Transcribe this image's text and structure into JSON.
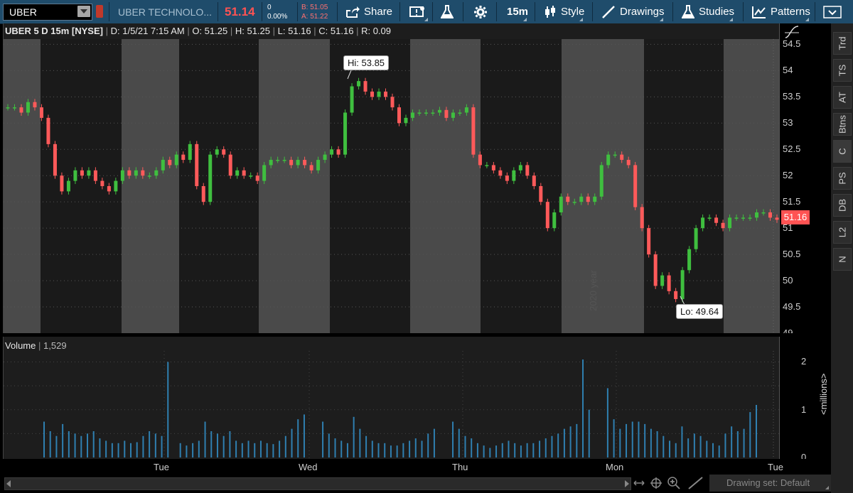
{
  "toolbar": {
    "symbol": "UBER",
    "company": "UBER TECHNOLO...",
    "last": "51.14",
    "change": "0",
    "change_pct": "0.00%",
    "bid": "B: 51.05",
    "ask": "A: 51.22",
    "share_label": "Share",
    "timeframe": "15m",
    "style_label": "Style",
    "drawings_label": "Drawings",
    "studies_label": "Studies",
    "patterns_label": "Patterns"
  },
  "chart_header": {
    "title": "UBER 5 D 15m [NYSE]",
    "date": "D: 1/5/21 7:15 AM",
    "open": "O: 51.25",
    "high": "H: 51.25",
    "low": "L: 51.16",
    "close": "C: 51.16",
    "range": "R: 0.09"
  },
  "volume_header": {
    "label": "Volume",
    "value": "1,529"
  },
  "labels": {
    "hi": "Hi: 53.85",
    "lo": "Lo: 49.64",
    "current_price": "51.16",
    "watermark": "2020 year",
    "millions": "<millions>",
    "drawing_set": "Drawing set: Default"
  },
  "price_axis_ticks": [
    "54.5",
    "54",
    "53.5",
    "53",
    "52.5",
    "52",
    "51.5",
    "51",
    "50.5",
    "50",
    "49.5",
    "49"
  ],
  "volume_axis_ticks": [
    "2",
    "1",
    "0"
  ],
  "time_ticks": [
    "Tue",
    "Wed",
    "Thu",
    "Mon",
    "Tue"
  ],
  "right_tabs": [
    "Trd",
    "TS",
    "AT",
    "Btns",
    "C",
    "PS",
    "DB",
    "L2",
    "N"
  ],
  "colors": {
    "up": "#3fbf3f",
    "down": "#ff5a5a",
    "volume": "#2f7fb0",
    "toolbar": "#1f4c6b"
  },
  "chart_data": {
    "type": "candlestick",
    "title": "UBER 5 D 15m [NYSE]",
    "ylim": [
      49,
      54.6
    ],
    "hi": 53.85,
    "lo": 49.64,
    "last": 51.16,
    "days": [
      "Tue",
      "Wed",
      "Thu",
      "Mon",
      "Tue"
    ],
    "close_path": [
      53.3,
      53.3,
      53.2,
      53.4,
      53.3,
      53.1,
      52.6,
      52.0,
      51.7,
      51.9,
      52.1,
      52.0,
      52.1,
      51.9,
      51.8,
      51.7,
      51.9,
      52.1,
      52.0,
      52.1,
      52.0,
      52.0,
      52.1,
      52.3,
      52.2,
      52.4,
      52.3,
      52.6,
      51.8,
      51.5,
      52.4,
      52.5,
      52.4,
      52.0,
      52.1,
      52.0,
      52.0,
      51.9,
      52.2,
      52.3,
      52.3,
      52.3,
      52.2,
      52.3,
      52.2,
      52.1,
      52.3,
      52.4,
      52.5,
      52.4,
      53.2,
      53.7,
      53.8,
      53.6,
      53.5,
      53.6,
      53.5,
      53.3,
      53.0,
      53.1,
      53.2,
      53.2,
      53.2,
      53.2,
      53.25,
      53.1,
      53.2,
      53.2,
      53.3,
      52.4,
      52.2,
      52.2,
      52.1,
      52.0,
      51.9,
      52.1,
      52.2,
      52.0,
      51.8,
      51.5,
      51.0,
      51.3,
      51.6,
      51.5,
      51.5,
      51.6,
      51.5,
      51.6,
      52.2,
      52.4,
      52.4,
      52.3,
      52.2,
      51.4,
      51.0,
      50.5,
      49.9,
      50.1,
      49.8,
      49.65,
      50.2,
      50.6,
      51.0,
      51.2,
      51.2,
      51.1,
      51.0,
      51.2,
      51.2,
      51.2,
      51.2,
      51.3,
      51.3,
      51.2,
      51.16
    ],
    "volume_millions": [
      0.75,
      0.55,
      0.45,
      0.7,
      0.55,
      0.5,
      0.45,
      0.5,
      0.55,
      0.4,
      0.35,
      0.3,
      0.3,
      0.35,
      0.3,
      0.32,
      0.45,
      0.55,
      0.5,
      0.45,
      2.0,
      0.0,
      0.3,
      0.25,
      0.3,
      0.35,
      0.75,
      0.55,
      0.5,
      0.45,
      0.55,
      0.35,
      0.3,
      0.35,
      0.3,
      0.35,
      0.3,
      0.28,
      0.35,
      0.45,
      0.6,
      0.8,
      0.9,
      0.0,
      0.0,
      0.75,
      0.5,
      0.4,
      0.35,
      0.3,
      0.85,
      0.6,
      0.45,
      0.35,
      0.3,
      0.3,
      0.25,
      0.25,
      0.3,
      0.35,
      0.4,
      0.35,
      0.5,
      0.6,
      0.0,
      0.0,
      0.75,
      0.6,
      0.45,
      0.4,
      0.3,
      0.25,
      0.2,
      0.25,
      0.3,
      0.35,
      0.3,
      0.25,
      0.3,
      0.3,
      0.35,
      0.4,
      0.45,
      0.5,
      0.6,
      0.65,
      0.7,
      2.05,
      1.0,
      0.0,
      0.0,
      1.45,
      0.8,
      0.6,
      0.7,
      0.75,
      0.75,
      0.7,
      0.6,
      0.55,
      0.45,
      0.35,
      0.3,
      0.65,
      0.4,
      0.5,
      0.45,
      0.35,
      0.3,
      0.25,
      0.5,
      0.65,
      0.55,
      0.6,
      0.95,
      1.1
    ]
  }
}
